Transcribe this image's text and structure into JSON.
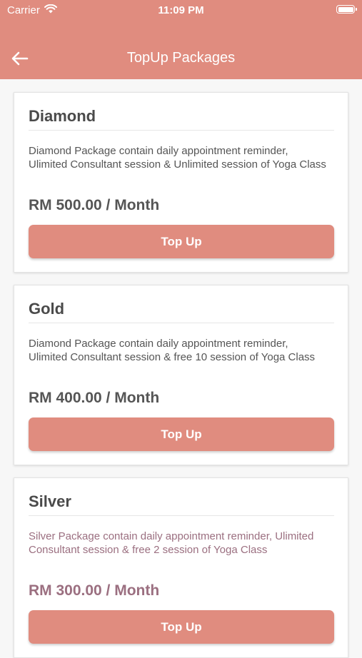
{
  "status_bar": {
    "carrier": "Carrier",
    "time": "11:09 PM"
  },
  "nav": {
    "title": "TopUp Packages",
    "back_icon": "arrow-left-icon"
  },
  "colors": {
    "accent": "#e08c7f",
    "background": "#f7f7f7"
  },
  "packages": [
    {
      "name": "Diamond",
      "description": "Diamond Package contain daily appointment reminder, Ulimited Consultant session & Unlimited session of Yoga Class",
      "price": "RM 500.00 / Month",
      "button": "Top Up"
    },
    {
      "name": "Gold",
      "description": "Diamond Package contain daily appointment reminder, Ulimited Consultant session & free 10 session of Yoga Class",
      "price": "RM 400.00 / Month",
      "button": "Top Up"
    },
    {
      "name": "Silver",
      "description": "Silver Package contain daily appointment reminder, Ulimited Consultant session & free 2 session of Yoga Class",
      "price": "RM 300.00 / Month",
      "button": "Top Up"
    }
  ]
}
